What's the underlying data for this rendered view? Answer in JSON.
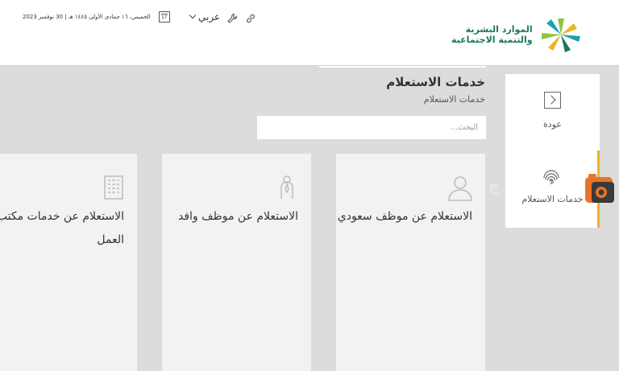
{
  "header": {
    "date": "الخميس، ١٦ جمادى الأولى ١٤٤٥ هـ | 30 نوفمبر 2023",
    "calendar_day": "17",
    "language": "عربي",
    "logo_line1": "الموارد البشرية",
    "logo_line2": "والتنمية الاجتماعية"
  },
  "sidebar": {
    "back_label": "عودة",
    "active_label": "خدمات الاستعلام"
  },
  "main": {
    "title": "خدمات الاستعلام",
    "breadcrumb": "خدمات الاستعلام",
    "search_placeholder": "البحث...",
    "cards": [
      {
        "label": "الاستعلام عن موظف سعودي",
        "icon": "person-icon"
      },
      {
        "label": "الاستعلام عن موظف وافد",
        "icon": "person-tie-icon"
      },
      {
        "label": "الاستعلام عن خدمات مكتب العمل",
        "icon": "building-icon"
      }
    ]
  },
  "badge_text": "ج",
  "colors": {
    "accent": "#f0b323",
    "brand_green": "#1b7a55",
    "badge_orange": "#e8742a"
  }
}
